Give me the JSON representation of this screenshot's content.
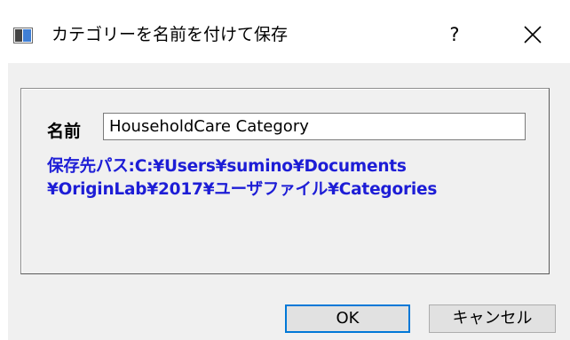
{
  "window": {
    "title": "カテゴリーを名前を付けて保存",
    "icon": "app-window-icon",
    "help_label": "?",
    "close_icon": "close-icon"
  },
  "form": {
    "name_label": "名前",
    "name_value": "HouseholdCare Category",
    "path_line1": "保存先パス:C:¥Users¥sumino¥Documents",
    "path_line2": "¥OriginLab¥2017¥ユーザファイル¥Categories"
  },
  "buttons": {
    "ok_label": "OK",
    "cancel_label": "キャンセル"
  },
  "colors": {
    "path_text": "#1d1dd6",
    "ok_border": "#0078d7",
    "dialog_bg": "#f0f0f0"
  }
}
